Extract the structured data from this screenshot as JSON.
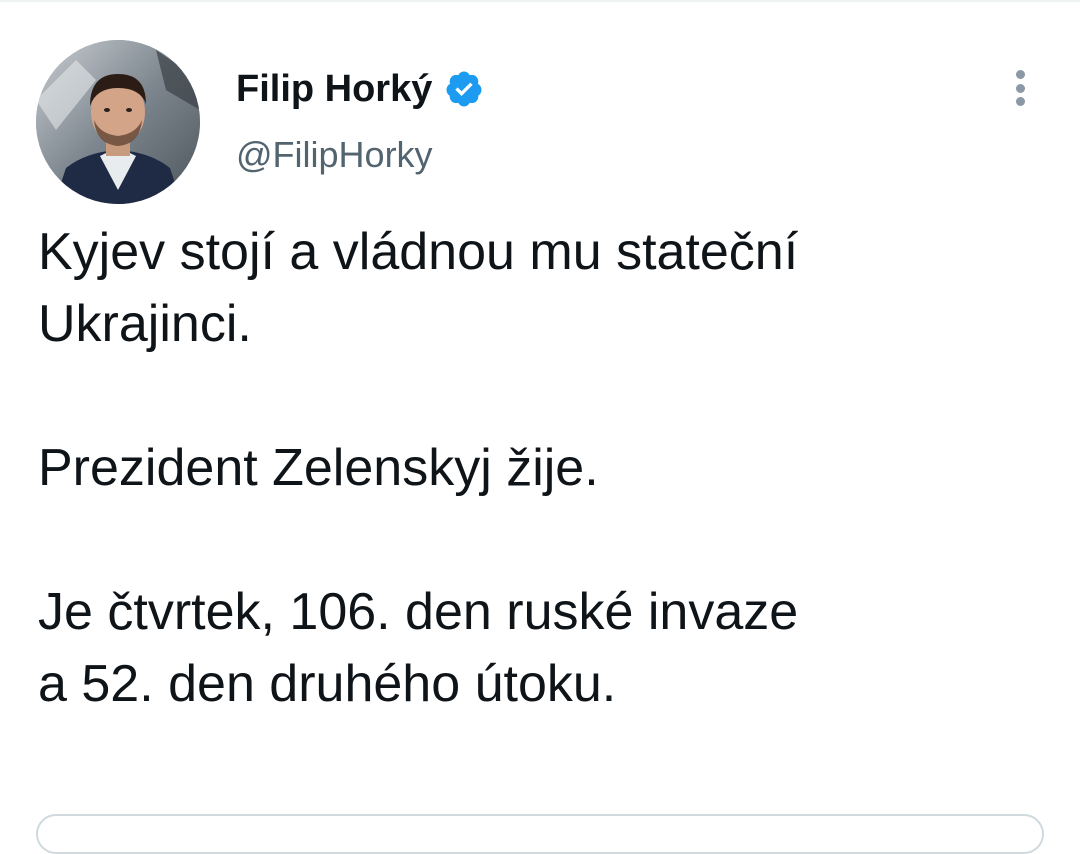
{
  "author": {
    "name": "Filip Horký",
    "handle": "@FilipHorky",
    "verified": true,
    "verified_color": "#1d9bf0"
  },
  "tweet": {
    "paragraphs": [
      [
        "Kyjev stojí a vládnou mu stateční",
        "Ukrajinci."
      ],
      [
        "Prezident Zelenskyj žije."
      ],
      [
        "Je čtvrtek, 106. den ruské invaze",
        "a 52. den druhého útoku."
      ]
    ]
  },
  "icons": {
    "verified": "verified-badge-icon",
    "more": "more-vertical-icon"
  }
}
